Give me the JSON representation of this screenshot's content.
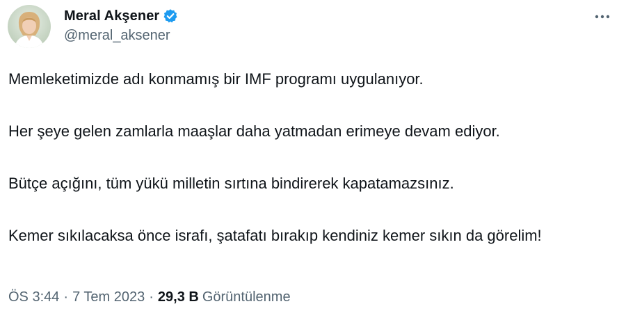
{
  "author": {
    "display_name": "Meral Akşener",
    "handle": "@meral_aksener",
    "verified_icon": "verified-badge-icon",
    "avatar_icon": "profile-photo-avatar"
  },
  "tweet": {
    "paragraphs": [
      "Memleketimizde adı konmamış bir IMF programı uygulanıyor.",
      "Her şeye gelen zamlarla maaşlar daha yatmadan erimeye devam ediyor.",
      "Bütçe açığını, tüm yükü milletin sırtına bindirerek kapatamazsınız.",
      "Kemer sıkılacaksa önce israfı, şatafatı bırakıp kendiniz kemer sıkın da görelim!"
    ]
  },
  "meta": {
    "time": "ÖS 3:44",
    "separator": "·",
    "date": "7 Tem 2023",
    "views_count": "29,3 B",
    "views_label": "Görüntülenme"
  },
  "menu": {
    "more_icon": "more-options-icon"
  },
  "colors": {
    "text_primary": "#0f1419",
    "text_secondary": "#536471",
    "verified_blue": "#1d9bf0",
    "background": "#ffffff"
  }
}
